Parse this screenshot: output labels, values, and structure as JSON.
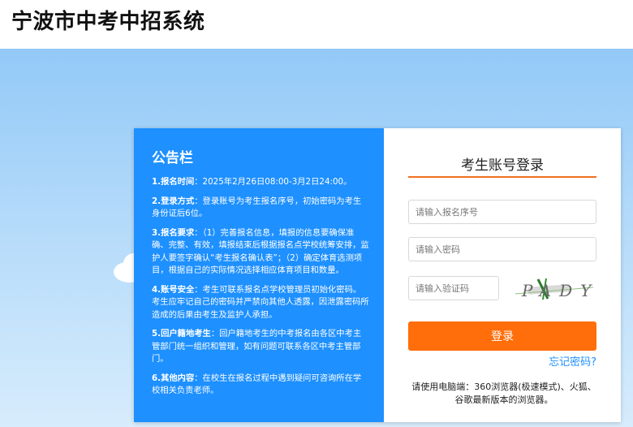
{
  "header": {
    "title": "宁波市中考中招系统"
  },
  "notice": {
    "title": "公告栏",
    "items": [
      {
        "label": "1.报名时间",
        "text": "：2025年2月26日08:00-3月2日24:00。"
      },
      {
        "label": "2.登录方式",
        "text": "：登录账号为考生报名序号，初始密码为考生身份证后6位。"
      },
      {
        "label": "3.报名要求",
        "text": "：（1）完善报名信息，填报的信息要确保准确、完整、有效，填报结束后根据报名点学校统筹安排，监护人要签字确认“考生报名确认表”；（2）确定体育选测项目，根据自己的实际情况选择相应体育项目和数量。"
      },
      {
        "label": "4.账号安全",
        "text": "：考生可联系报名点学校管理员初始化密码。考生应牢记自己的密码并严禁向其他人透露，因泄露密码所造成的后果由考生及监护人承担。"
      },
      {
        "label": "5.回户籍地考生",
        "text": "：回户籍地考生的中考报名由各区中考主管部门统一组织和管理，如有问题可联系各区中考主管部门。"
      },
      {
        "label": "6.其他内容",
        "text": "：在校生在报名过程中遇到疑问可咨询所在学校相关负责老师。"
      }
    ]
  },
  "login": {
    "title": "考生账号登录",
    "username_placeholder": "请输入报名序号",
    "password_placeholder": "请输入密码",
    "captcha_placeholder": "请输入验证码",
    "captcha_text": "PADY",
    "submit_label": "登录",
    "forgot_label": "忘记密码?",
    "browser_tip": "请使用电脑端：360浏览器(极速模式)、火狐、谷歌最新版本的浏览器。"
  },
  "colors": {
    "accent_orange": "#ff6e0a",
    "notice_blue": "#1e90ff",
    "link_blue": "#1e90ff"
  }
}
